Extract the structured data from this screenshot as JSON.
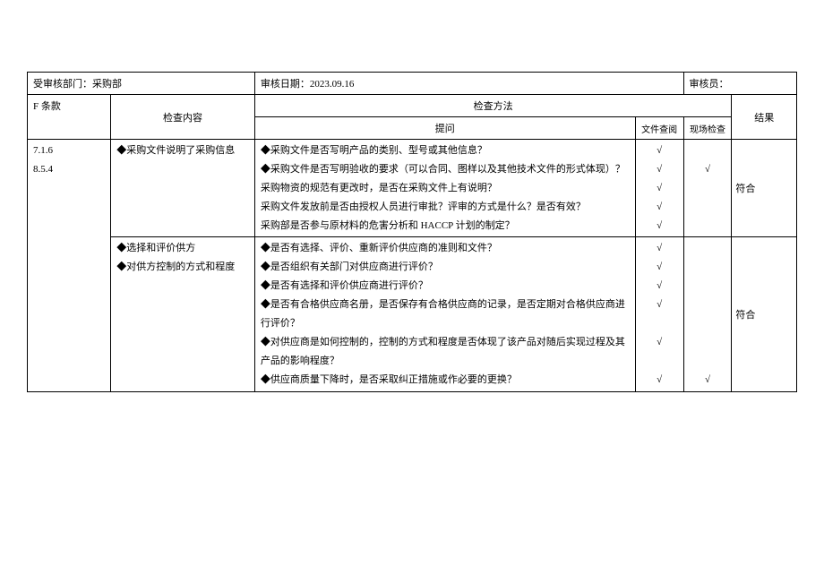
{
  "header": {
    "audited_dept_label": "受审核部门：采购部",
    "audit_date_label": "审核日期：2023.09.16",
    "auditor_label": "审核员："
  },
  "columns": {
    "clause": "F 条款",
    "content": "检查内容",
    "method": "检查方法",
    "question": "提问",
    "doc_review": "文件查阅",
    "site_check": "现场检查",
    "result": "结果"
  },
  "section1": {
    "clauses": "7.1.6\n8.5.4",
    "content": "◆采购文件说明了采购信息",
    "questions": "◆采购文件是否写明产品的类别、型号或其他信息？\n◆采购文件是否写明验收的要求（可以合同、图样以及其他技术文件的形式体现）？\n 采购物资的规范有更改时，是否在采购文件上有说明？\n 采购文件发放前是否由授权人员进行审批？评审的方式是什么？是否有效？\n 采购部是否参与原材料的危害分析和 HACCP 计划的制定？",
    "doc_ticks": "√\n√\n√\n√\n√",
    "site_ticks": "\n√\n\n\n",
    "result": "符合"
  },
  "section2": {
    "content": "◆选择和评价供方\n◆对供方控制的方式和程度",
    "questions": "◆是否有选择、评价、重新评价供应商的准则和文件？\n◆是否组织有关部门对供应商进行评价？\n◆是否有选择和评价供应商进行评价？\n◆是否有合格供应商名册，是否保存有合格供应商的记录，是否定期对合格供应商进行评价？\n◆对供应商是如何控制的，控制的方式和程度是否体现了该产品对随后实现过程及其产品的影响程度？\n◆供应商质量下降时，是否采取纠正措施或作必要的更换？\n",
    "doc_ticks": "√\n√\n√\n√\n\n√\n\n√",
    "site_ticks": "\n\n\n\n\n\n\n√",
    "result": "符合"
  }
}
